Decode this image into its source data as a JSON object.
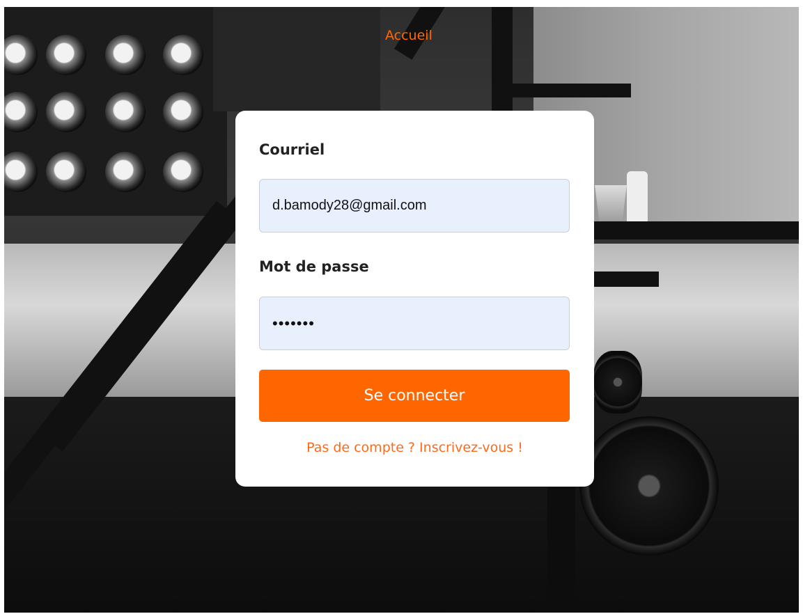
{
  "nav": {
    "home_label": "Accueil"
  },
  "login": {
    "email_label": "Courriel",
    "email_value": "d.bamody28@gmail.com",
    "password_label": "Mot de passe",
    "password_value": "•••••••",
    "submit_label": "Se connecter",
    "signup_link": "Pas de compte ? Inscrivez-vous !"
  },
  "colors": {
    "accent": "#ff6600",
    "input_bg": "#e8f0fe",
    "card_bg": "#ffffff"
  },
  "icons": {
    "background": "gym-photo-background"
  }
}
